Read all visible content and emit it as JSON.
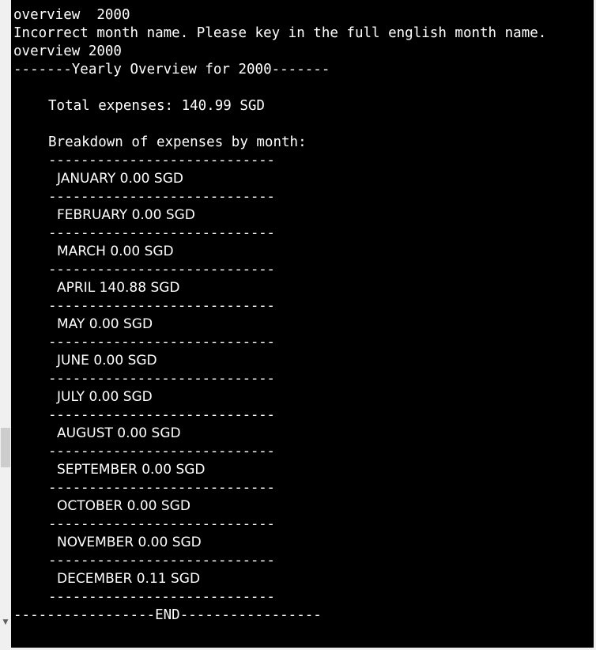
{
  "console": {
    "lines": [
      "overview  2000",
      "Incorrect month name. Please key in the full english month name.",
      "overview 2000",
      "-------Yearly Overview for 2000-------"
    ],
    "total_expenses": "Total expenses: 140.99 SGD",
    "breakdown_heading": "Breakdown of expenses by month:",
    "separator": "----------------------------",
    "months": [
      "JANUARY 0.00 SGD",
      "FEBRUARY 0.00 SGD",
      "MARCH 0.00 SGD",
      "APRIL 140.88 SGD",
      "MAY 0.00 SGD",
      "JUNE 0.00 SGD",
      "JULY 0.00 SGD",
      "AUGUST 0.00 SGD",
      "SEPTEMBER 0.00 SGD",
      "OCTOBER 0.00 SGD",
      "NOVEMBER 0.00 SGD",
      "DECEMBER 0.11 SGD"
    ],
    "end_line": "-----------------END-----------------"
  },
  "colors": {
    "background": "#000000",
    "text": "#ffffff",
    "scrollbar_track": "#f0f0f0",
    "scrollbar_thumb": "#cdcdcd"
  },
  "icons": {
    "scroll_down": "scroll-down-arrow-icon"
  }
}
